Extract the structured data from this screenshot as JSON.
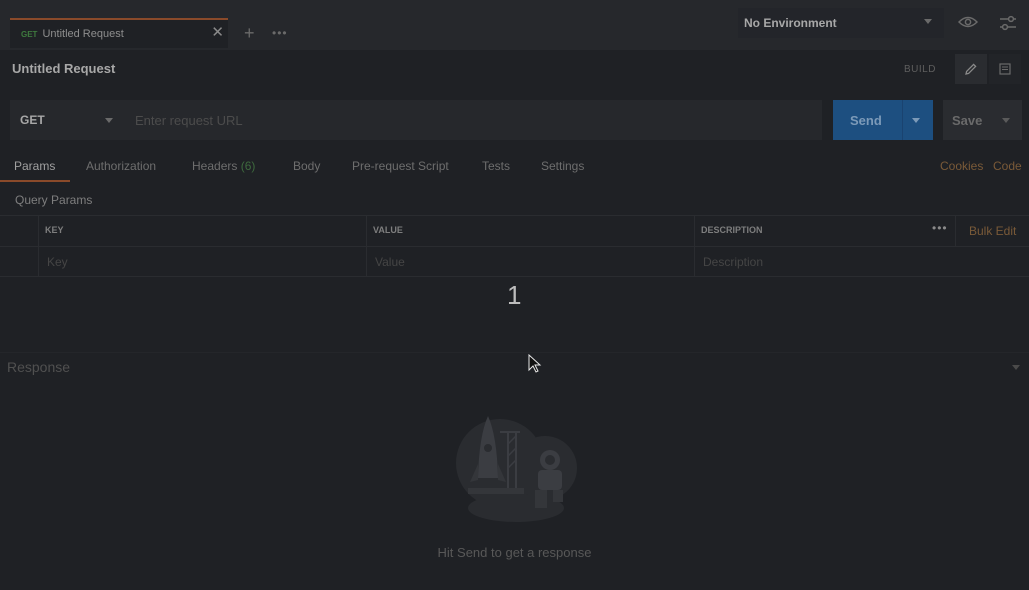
{
  "tab": {
    "method": "GET",
    "title": "Untitled Request",
    "close": "✕",
    "add": "+",
    "more": "•••"
  },
  "environment": {
    "selected": "No Environment"
  },
  "request": {
    "title": "Untitled Request",
    "mode_label": "BUILD"
  },
  "url_bar": {
    "method": "GET",
    "placeholder": "Enter request URL",
    "send_label": "Send",
    "save_label": "Save"
  },
  "request_tabs": [
    {
      "label": "Params"
    },
    {
      "label": "Authorization"
    },
    {
      "label": "Headers",
      "badge": "(6)"
    },
    {
      "label": "Body"
    },
    {
      "label": "Pre-request Script"
    },
    {
      "label": "Tests"
    },
    {
      "label": "Settings"
    }
  ],
  "links": {
    "cookies": "Cookies",
    "code": "Code"
  },
  "query_params": {
    "title": "Query Params",
    "headers": [
      "KEY",
      "VALUE",
      "DESCRIPTION"
    ],
    "placeholders": [
      "Key",
      "Value",
      "Description"
    ],
    "bulk_edit": "Bulk Edit",
    "more": "•••"
  },
  "overlay_number": "1",
  "response": {
    "label": "Response",
    "hint": "Hit Send to get a response"
  },
  "colors": {
    "accent": "#8a4a2a",
    "send": "#1d4f80",
    "link": "#7a5a38"
  }
}
